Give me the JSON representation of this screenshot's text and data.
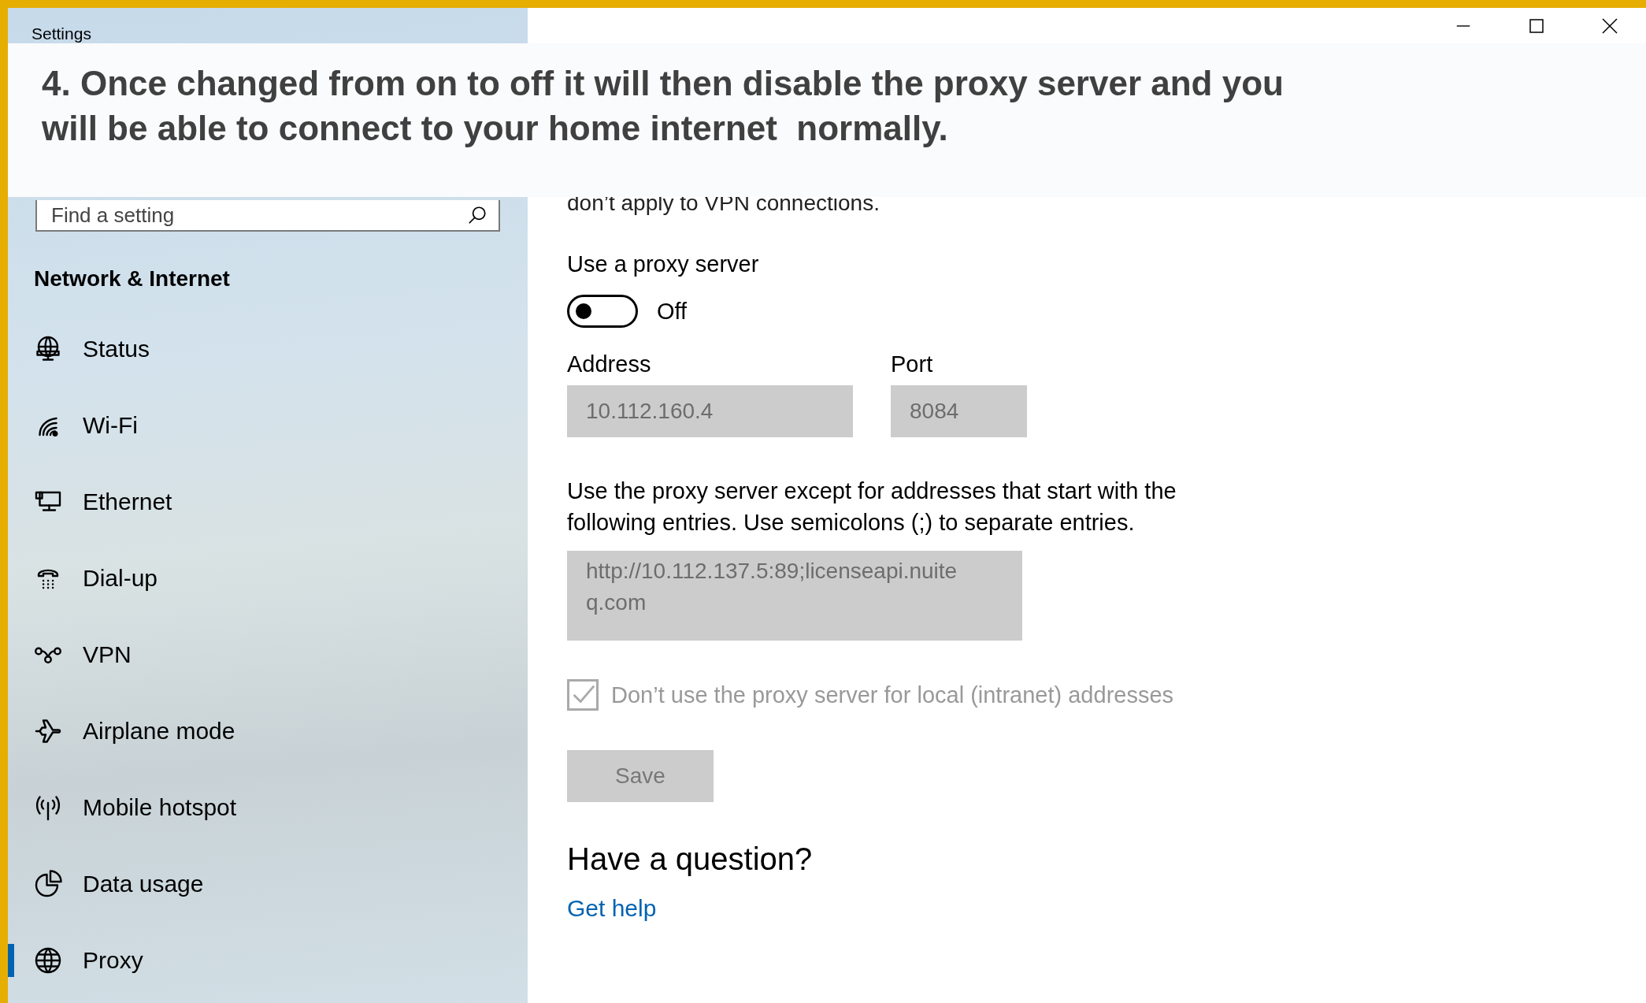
{
  "window": {
    "title": "Settings",
    "controls": [
      {
        "kind": "minimize"
      },
      {
        "kind": "maximize"
      },
      {
        "kind": "close"
      }
    ]
  },
  "caption": "4. Once changed from on to off it will then disable the proxy server and you will be able to connect to your home internet  normally.",
  "sidebar": {
    "search": {
      "placeholder": "Find a setting"
    },
    "section": "Network & Internet",
    "items": [
      {
        "label": "Status",
        "selected": false
      },
      {
        "label": "Wi-Fi",
        "selected": false
      },
      {
        "label": "Ethernet",
        "selected": false
      },
      {
        "label": "Dial-up",
        "selected": false
      },
      {
        "label": "VPN",
        "selected": false
      },
      {
        "label": "Airplane mode",
        "selected": false
      },
      {
        "label": "Mobile hotspot",
        "selected": false
      },
      {
        "label": "Data usage",
        "selected": false
      },
      {
        "label": "Proxy",
        "selected": true
      }
    ]
  },
  "main": {
    "description": "don’t apply to VPN connections.",
    "toggle": {
      "label": "Use a proxy server",
      "on": false,
      "state_text": "Off"
    },
    "address": {
      "label": "Address",
      "value": "10.112.160.4",
      "disabled": true
    },
    "port": {
      "label": "Port",
      "value": "8084",
      "disabled": true
    },
    "exceptions": {
      "label": "Use the proxy server except for addresses that start with the following entries. Use semicolons (;) to separate entries.",
      "value": "http://10.112.137.5:89;licenseapi.nuiteq.com",
      "disabled": true
    },
    "local_checkbox": {
      "label": "Don’t use the proxy server for local (intranet) addresses",
      "checked": true,
      "disabled": true
    },
    "save": {
      "label": "Save",
      "disabled": true
    },
    "help": {
      "heading": "Have a question?",
      "link": "Get help"
    }
  }
}
